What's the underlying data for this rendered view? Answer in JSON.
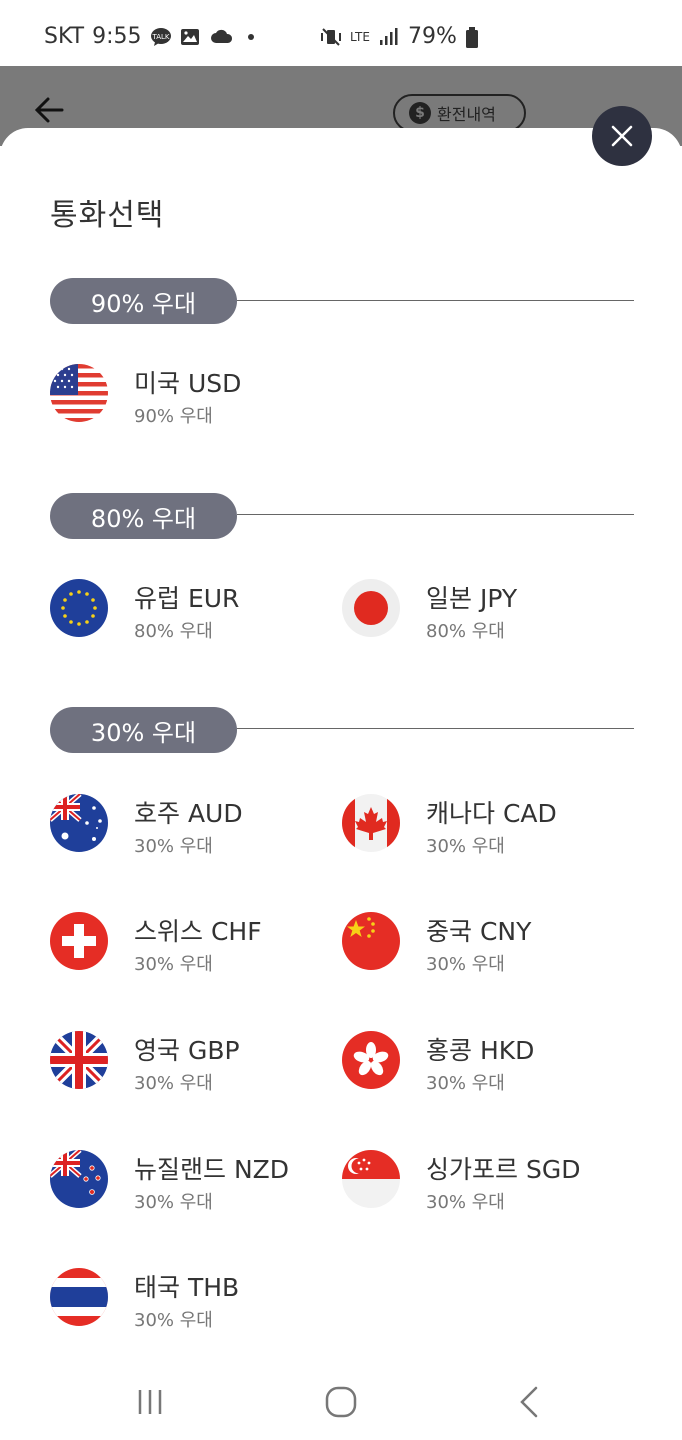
{
  "status_bar": {
    "carrier": "SKT",
    "time": "9:55",
    "network": "LTE",
    "battery": "79%"
  },
  "header": {
    "exchange_history_label": "환전내역"
  },
  "sheet": {
    "title": "통화선택",
    "sections": [
      {
        "label": "90% 우대",
        "items": [
          {
            "name": "미국 USD",
            "sub": "90% 우대",
            "flag": "us-flag-icon"
          }
        ]
      },
      {
        "label": "80% 우대",
        "items": [
          {
            "name": "유럽 EUR",
            "sub": "80% 우대",
            "flag": "eu-flag-icon"
          },
          {
            "name": "일본 JPY",
            "sub": "80% 우대",
            "flag": "japan-flag-icon"
          }
        ]
      },
      {
        "label": "30% 우대",
        "items": [
          {
            "name": "호주 AUD",
            "sub": "30% 우대",
            "flag": "australia-flag-icon"
          },
          {
            "name": "캐나다 CAD",
            "sub": "30% 우대",
            "flag": "canada-flag-icon"
          },
          {
            "name": "스위스 CHF",
            "sub": "30% 우대",
            "flag": "switzerland-flag-icon"
          },
          {
            "name": "중국 CNY",
            "sub": "30% 우대",
            "flag": "china-flag-icon"
          },
          {
            "name": "영국 GBP",
            "sub": "30% 우대",
            "flag": "uk-flag-icon"
          },
          {
            "name": "홍콩 HKD",
            "sub": "30% 우대",
            "flag": "hongkong-flag-icon"
          },
          {
            "name": "뉴질랜드 NZD",
            "sub": "30% 우대",
            "flag": "newzealand-flag-icon"
          },
          {
            "name": "싱가포르 SGD",
            "sub": "30% 우대",
            "flag": "singapore-flag-icon"
          },
          {
            "name": "태국 THB",
            "sub": "30% 우대",
            "flag": "thailand-flag-icon"
          }
        ]
      }
    ]
  },
  "colors": {
    "pill_bg": "#6f717f",
    "close_bg": "#2e3140",
    "dim_overlay": "#7a7a7a"
  }
}
